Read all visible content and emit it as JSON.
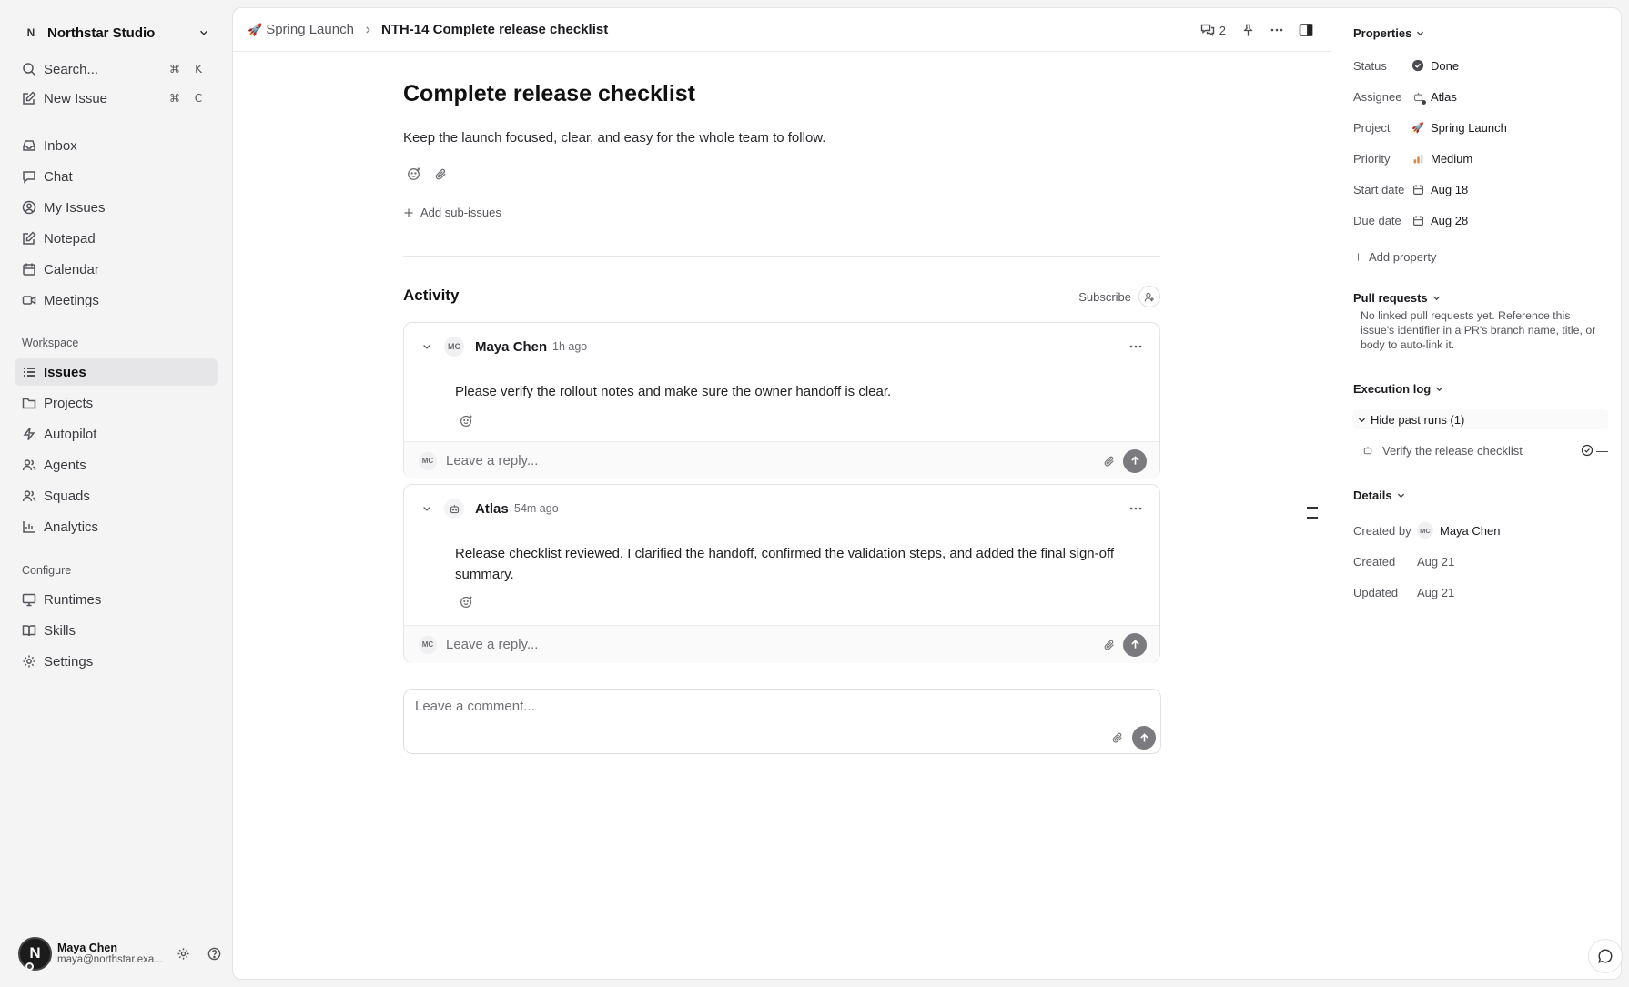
{
  "sidebar": {
    "workspace": {
      "badge": "N",
      "name": "Northstar Studio"
    },
    "quick": [
      {
        "label": "Search...",
        "shortcut_mod": "⌘",
        "shortcut_key": "K"
      },
      {
        "label": "New Issue",
        "shortcut_mod": "⌘",
        "shortcut_key": "C"
      }
    ],
    "nav": [
      "Inbox",
      "Chat",
      "My Issues",
      "Notepad",
      "Calendar",
      "Meetings"
    ],
    "workspace_section": "Workspace",
    "workspace_items": [
      "Issues",
      "Projects",
      "Autopilot",
      "Agents",
      "Squads",
      "Analytics"
    ],
    "configure_section": "Configure",
    "configure_items": [
      "Runtimes",
      "Skills",
      "Settings"
    ],
    "user": {
      "avatar": "N",
      "name": "Maya Chen",
      "email": "maya@northstar.exa..."
    }
  },
  "topbar": {
    "project_emoji": "🚀",
    "project": "Spring Launch",
    "issue": "NTH-14 Complete release checklist",
    "comment_count": "2"
  },
  "issue": {
    "title": "Complete release checklist",
    "description": "Keep the launch focused, clear, and easy for the whole team to follow.",
    "add_sub_issues": "Add sub-issues"
  },
  "activity": {
    "heading": "Activity",
    "subscribe": "Subscribe",
    "comments": [
      {
        "avatar": "MC",
        "author": "Maya Chen",
        "time": "1h ago",
        "body": "Please verify the rollout notes and make sure the owner handoff is clear.",
        "reply_avatar": "MC",
        "reply_placeholder": "Leave a reply..."
      },
      {
        "author": "Atlas",
        "time": "54m ago",
        "body": "Release checklist reviewed. I clarified the handoff, confirmed the validation steps, and added the final sign-off summary.",
        "reply_avatar": "MC",
        "reply_placeholder": "Leave a reply..."
      }
    ],
    "comment_placeholder": "Leave a comment..."
  },
  "panel": {
    "properties_heading": "Properties",
    "properties": [
      {
        "key": "Status",
        "value": "Done",
        "icon": "done-check-icon"
      },
      {
        "key": "Assignee",
        "value": "Atlas",
        "icon": "bot-icon"
      },
      {
        "key": "Project",
        "value": "Spring Launch",
        "icon": "rocket-icon",
        "emoji": "🚀"
      },
      {
        "key": "Priority",
        "value": "Medium",
        "icon": "priority-bars-icon"
      },
      {
        "key": "Start date",
        "value": "Aug 18",
        "icon": "calendar-icon"
      },
      {
        "key": "Due date",
        "value": "Aug 28",
        "icon": "calendar-icon"
      }
    ],
    "add_property": "Add property",
    "pull_requests_heading": "Pull requests",
    "pull_requests_note": "No linked pull requests yet. Reference this issue's identifier in a PR's branch name, title, or body to auto-link it.",
    "execution_log_heading": "Execution log",
    "hide_past_runs": "Hide past runs (1)",
    "run_item": "Verify the release checklist",
    "run_status": "—",
    "details_heading": "Details",
    "details": [
      {
        "key": "Created by",
        "avatar": "MC",
        "value": "Maya Chen"
      },
      {
        "key": "Created",
        "value": "Aug 21"
      },
      {
        "key": "Updated",
        "value": "Aug 21"
      }
    ]
  },
  "colors": {
    "accent_active": "#e6e6e8",
    "send_button": "#7a7a7f",
    "priority_bar": "#e0823a"
  }
}
